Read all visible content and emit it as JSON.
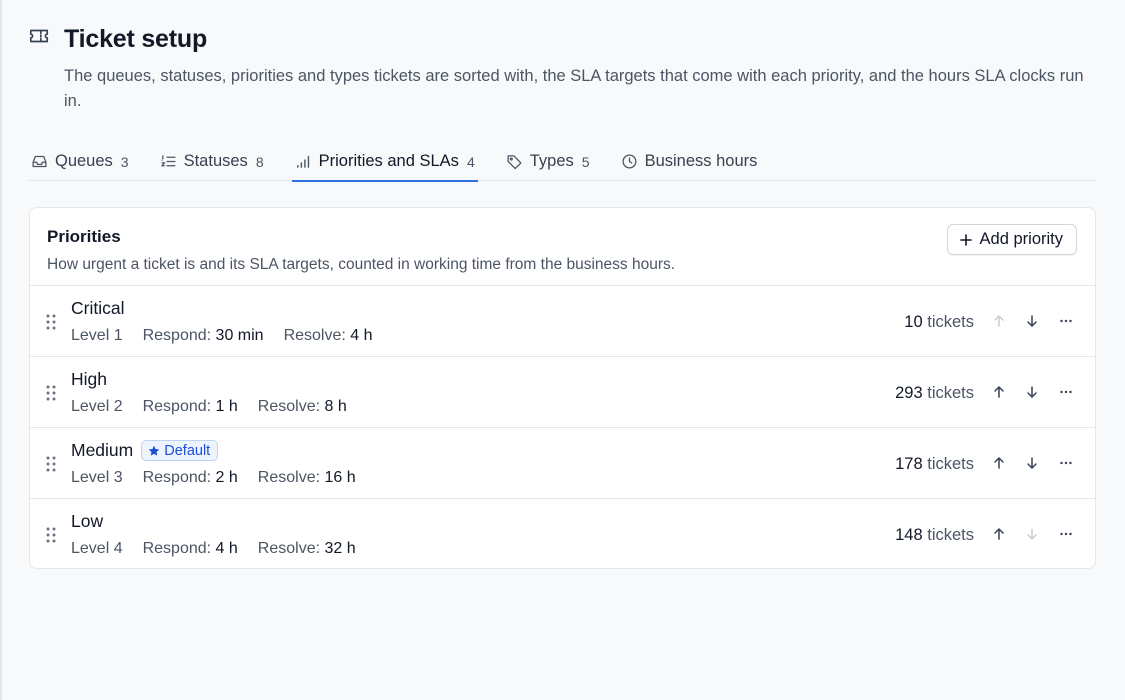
{
  "page": {
    "title": "Ticket setup",
    "subtitle": "The queues, statuses, priorities and types tickets are sorted with, the SLA targets that come with each priority, and the hours SLA clocks run in.",
    "title_icon": "ticket-icon"
  },
  "tabs": [
    {
      "label": "Queues",
      "count": "3",
      "icon": "inbox-icon"
    },
    {
      "label": "Statuses",
      "count": "8",
      "icon": "list-ordered-icon"
    },
    {
      "label": "Priorities and SLAs",
      "count": "4",
      "icon": "signal-bars-icon",
      "active": true
    },
    {
      "label": "Types",
      "count": "5",
      "icon": "tag-icon"
    },
    {
      "label": "Business hours",
      "count": "",
      "icon": "clock-icon"
    }
  ],
  "card": {
    "title": "Priorities",
    "description": "How urgent a ticket is and its SLA targets, counted in working time from the business hours.",
    "add_label": "Add priority"
  },
  "labels": {
    "respond": "Respond:",
    "resolve": "Resolve:",
    "tickets": "tickets"
  },
  "priorities": [
    {
      "name": "Critical",
      "level": "Level 1",
      "respond": "30 min",
      "resolve": "4 h",
      "tickets": "10",
      "default_badge": ""
    },
    {
      "name": "High",
      "level": "Level 2",
      "respond": "1 h",
      "resolve": "8 h",
      "tickets": "293",
      "default_badge": ""
    },
    {
      "name": "Medium",
      "level": "Level 3",
      "respond": "2 h",
      "resolve": "16 h",
      "tickets": "178",
      "default_badge": "Default"
    },
    {
      "name": "Low",
      "level": "Level 4",
      "respond": "4 h",
      "resolve": "32 h",
      "tickets": "148",
      "default_badge": ""
    }
  ],
  "colors": {
    "accent": "#2f6fe0",
    "badge_bg": "#eef4fe",
    "badge_text": "#1d4ed8"
  }
}
